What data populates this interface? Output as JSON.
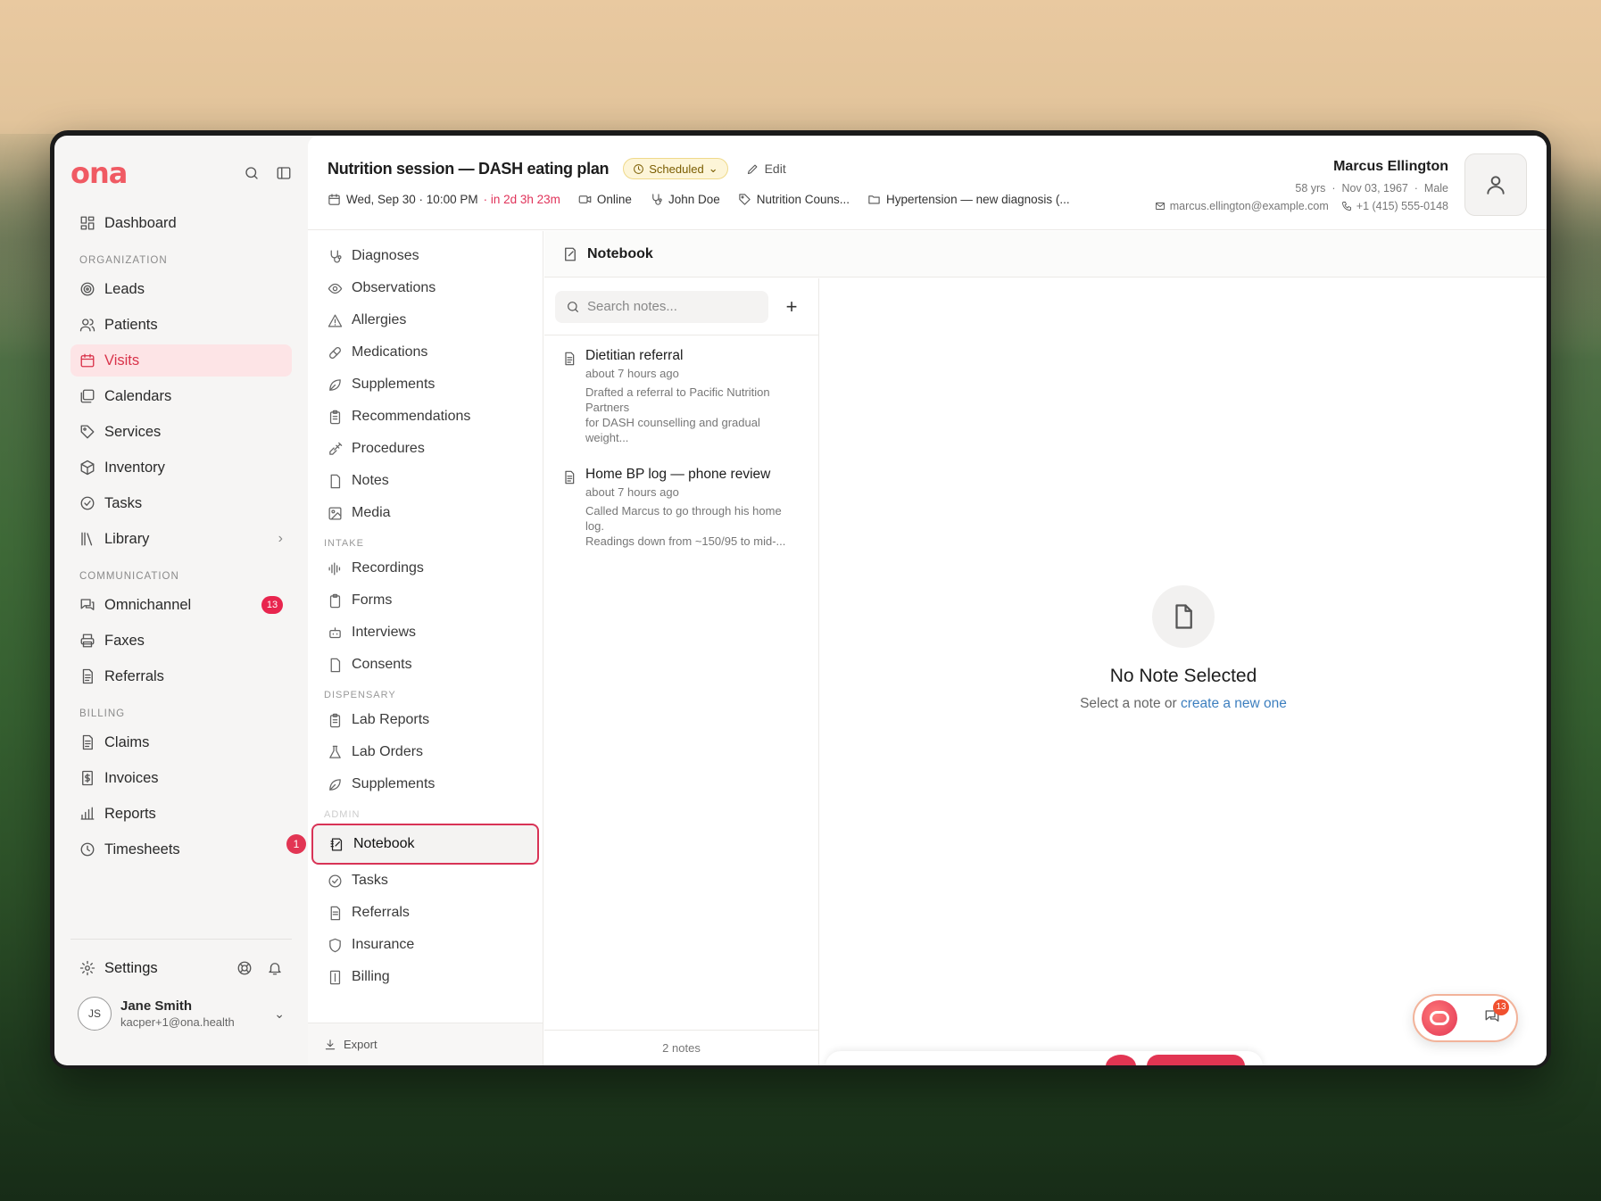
{
  "app": {
    "logo": "ona",
    "sidebar": {
      "nav": [
        {
          "label": "Dashboard",
          "icon": "dashboard-icon"
        }
      ],
      "sections": [
        {
          "title": "ORGANIZATION",
          "items": [
            {
              "label": "Leads",
              "icon": "target-icon"
            },
            {
              "label": "Patients",
              "icon": "users-icon"
            },
            {
              "label": "Visits",
              "icon": "calendar-icon",
              "active": true
            },
            {
              "label": "Calendars",
              "icon": "calendars-icon"
            },
            {
              "label": "Services",
              "icon": "tag-icon"
            },
            {
              "label": "Inventory",
              "icon": "box-icon"
            },
            {
              "label": "Tasks",
              "icon": "check-circle-icon"
            },
            {
              "label": "Library",
              "icon": "library-icon"
            }
          ]
        },
        {
          "title": "COMMUNICATION",
          "items": [
            {
              "label": "Omnichannel",
              "icon": "chat-icon",
              "badge": "13"
            },
            {
              "label": "Faxes",
              "icon": "printer-icon"
            },
            {
              "label": "Referrals",
              "icon": "document-icon"
            }
          ]
        },
        {
          "title": "BILLING",
          "items": [
            {
              "label": "Claims",
              "icon": "document-icon"
            },
            {
              "label": "Invoices",
              "icon": "invoice-icon"
            },
            {
              "label": "Reports",
              "icon": "chart-icon"
            },
            {
              "label": "Timesheets",
              "icon": "clock-icon"
            }
          ]
        }
      ],
      "settings_label": "Settings",
      "user": {
        "initials": "JS",
        "name": "Jane Smith",
        "email": "kacper+1@ona.health"
      }
    },
    "colors": {
      "accent": "#e23553",
      "logo": "#f05a63",
      "link": "#3d7fbf",
      "status_bg": "#fdf5d8"
    }
  },
  "visit": {
    "title": "Nutrition session — DASH eating plan",
    "status": "Scheduled",
    "edit_label": "Edit",
    "datetime": "Wed, Sep 30 · 10:00 PM",
    "countdown": "· in 2d 3h 23m",
    "location": "Online",
    "provider": "John Doe",
    "service": "Nutrition Couns...",
    "case": "Hypertension — new diagnosis (..."
  },
  "patient": {
    "name": "Marcus Ellington",
    "age": "58 yrs",
    "dob": "Nov 03, 1967",
    "sex": "Male",
    "email": "marcus.ellington@example.com",
    "phone": "+1 (415) 555-0148"
  },
  "subnav": {
    "top": [
      {
        "label": "Diagnoses",
        "icon": "stethoscope-icon"
      },
      {
        "label": "Observations",
        "icon": "eye-icon"
      },
      {
        "label": "Allergies",
        "icon": "warning-icon"
      },
      {
        "label": "Medications",
        "icon": "pill-icon"
      },
      {
        "label": "Supplements",
        "icon": "leaf-icon"
      },
      {
        "label": "Recommendations",
        "icon": "clipboard-icon"
      },
      {
        "label": "Procedures",
        "icon": "syringe-icon"
      },
      {
        "label": "Notes",
        "icon": "file-icon"
      },
      {
        "label": "Media",
        "icon": "image-icon"
      }
    ],
    "intake_title": "INTAKE",
    "intake": [
      {
        "label": "Recordings",
        "icon": "waveform-icon"
      },
      {
        "label": "Forms",
        "icon": "clipboard-icon"
      },
      {
        "label": "Interviews",
        "icon": "bot-icon"
      },
      {
        "label": "Consents",
        "icon": "file-icon"
      }
    ],
    "dispensary_title": "DISPENSARY",
    "dispensary": [
      {
        "label": "Lab Reports",
        "icon": "clipboard-icon"
      },
      {
        "label": "Lab Orders",
        "icon": "flask-icon"
      },
      {
        "label": "Supplements",
        "icon": "leaf-icon"
      }
    ],
    "admin_title": "ADMIN",
    "admin": [
      {
        "label": "Notebook",
        "icon": "notebook-icon",
        "active": true
      },
      {
        "label": "Tasks",
        "icon": "check-circle-icon"
      },
      {
        "label": "Referrals",
        "icon": "document-icon"
      },
      {
        "label": "Insurance",
        "icon": "shield-icon"
      },
      {
        "label": "Billing",
        "icon": "invoice-icon"
      }
    ],
    "step_number": "1",
    "export_label": "Export"
  },
  "notebook": {
    "title": "Notebook",
    "search_placeholder": "Search notes...",
    "notes": [
      {
        "title": "Dietitian referral",
        "time": "about 7 hours ago",
        "snippet_1": "Drafted a referral to Pacific Nutrition Partners",
        "snippet_2": "for DASH counselling and gradual weight..."
      },
      {
        "title": "Home BP log — phone review",
        "time": "about 7 hours ago",
        "snippet_1": "Called Marcus to go through his home log.",
        "snippet_2": "Readings down from ~150/95 to mid-..."
      }
    ],
    "count": "2 notes",
    "empty_title": "No Note Selected",
    "empty_text": "Select a note or",
    "empty_link": "create a new one"
  },
  "chat": {
    "badge": "13"
  }
}
